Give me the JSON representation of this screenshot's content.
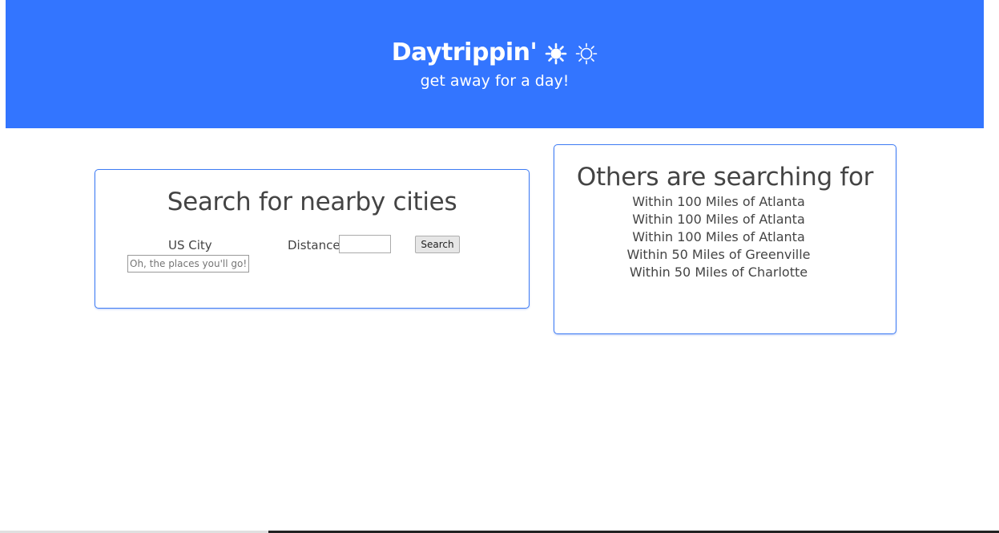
{
  "header": {
    "title": "Daytrippin'",
    "subtitle": "get away for a day!",
    "icons": [
      "sun-filled-icon",
      "sun-outline-icon"
    ],
    "background_color": "#3375ff"
  },
  "search_card": {
    "title": "Search for nearby cities",
    "city_label": "US City",
    "city_placeholder": "Oh, the places you'll go!",
    "distance_label": "Distance",
    "distance_value": "",
    "search_button_label": "Search"
  },
  "others_card": {
    "title": "Others are searching for",
    "items": [
      "Within 100 Miles of Atlanta",
      "Within 100 Miles of Atlanta",
      "Within 100 Miles of Atlanta",
      "Within 50 Miles of Greenville",
      "Within 50 Miles of Charlotte"
    ]
  },
  "colors": {
    "accent": "#3375ff",
    "card_border": "#3f7cf4",
    "text": "#444444"
  }
}
